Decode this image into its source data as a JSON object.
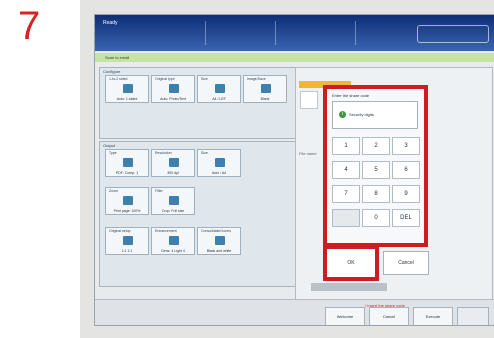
{
  "step_number": "7",
  "titlebar": {
    "status": "Ready"
  },
  "breadcrumb": "Scan to email",
  "groups": {
    "g1": "Configure",
    "g2": "Size",
    "g3": "Image quality",
    "g4": "Color",
    "g5": "Output",
    "g6": "Original setup",
    "g7": "Enhancement",
    "g8": "Consolidated tones"
  },
  "tiles": [
    {
      "label": "1-to-2 sided",
      "value": "Auto: 1-sided"
    },
    {
      "label": "Original type",
      "value": "Auto: Photo/Text"
    },
    {
      "label": "Size",
      "value": "A4 / LEF"
    },
    {
      "label": "Image/Save",
      "value": "Blank"
    },
    {
      "label": "Type",
      "value": "PDF: Comp. 1"
    },
    {
      "label": "Resolution",
      "value": "300 dpi"
    },
    {
      "label": "Size",
      "value": "Auto / A4"
    },
    {
      "label": "Zoom",
      "value": "Print page: 100%"
    },
    {
      "label": "Filter",
      "value": "Crop: Full size"
    },
    {
      "label": "Original setup",
      "value": "1:1  1:1"
    },
    {
      "label": "Enhancement",
      "value": "Dens. 4  Light 4"
    },
    {
      "label": "Consolidated tones",
      "value": "Black and white"
    }
  ],
  "right_panel": {
    "side_label": "File name"
  },
  "keypad": {
    "title": "Enter the share code",
    "display_text": "Security digits",
    "keys": [
      "1",
      "2",
      "3",
      "4",
      "5",
      "6",
      "7",
      "8",
      "9",
      "",
      "0",
      "DEL"
    ],
    "ok_label": "OK",
    "cancel_label": "Cancel"
  },
  "alert_text": "! Insert the share code",
  "bottom_buttons": [
    "Welcome",
    "Cancel",
    "Execute"
  ]
}
